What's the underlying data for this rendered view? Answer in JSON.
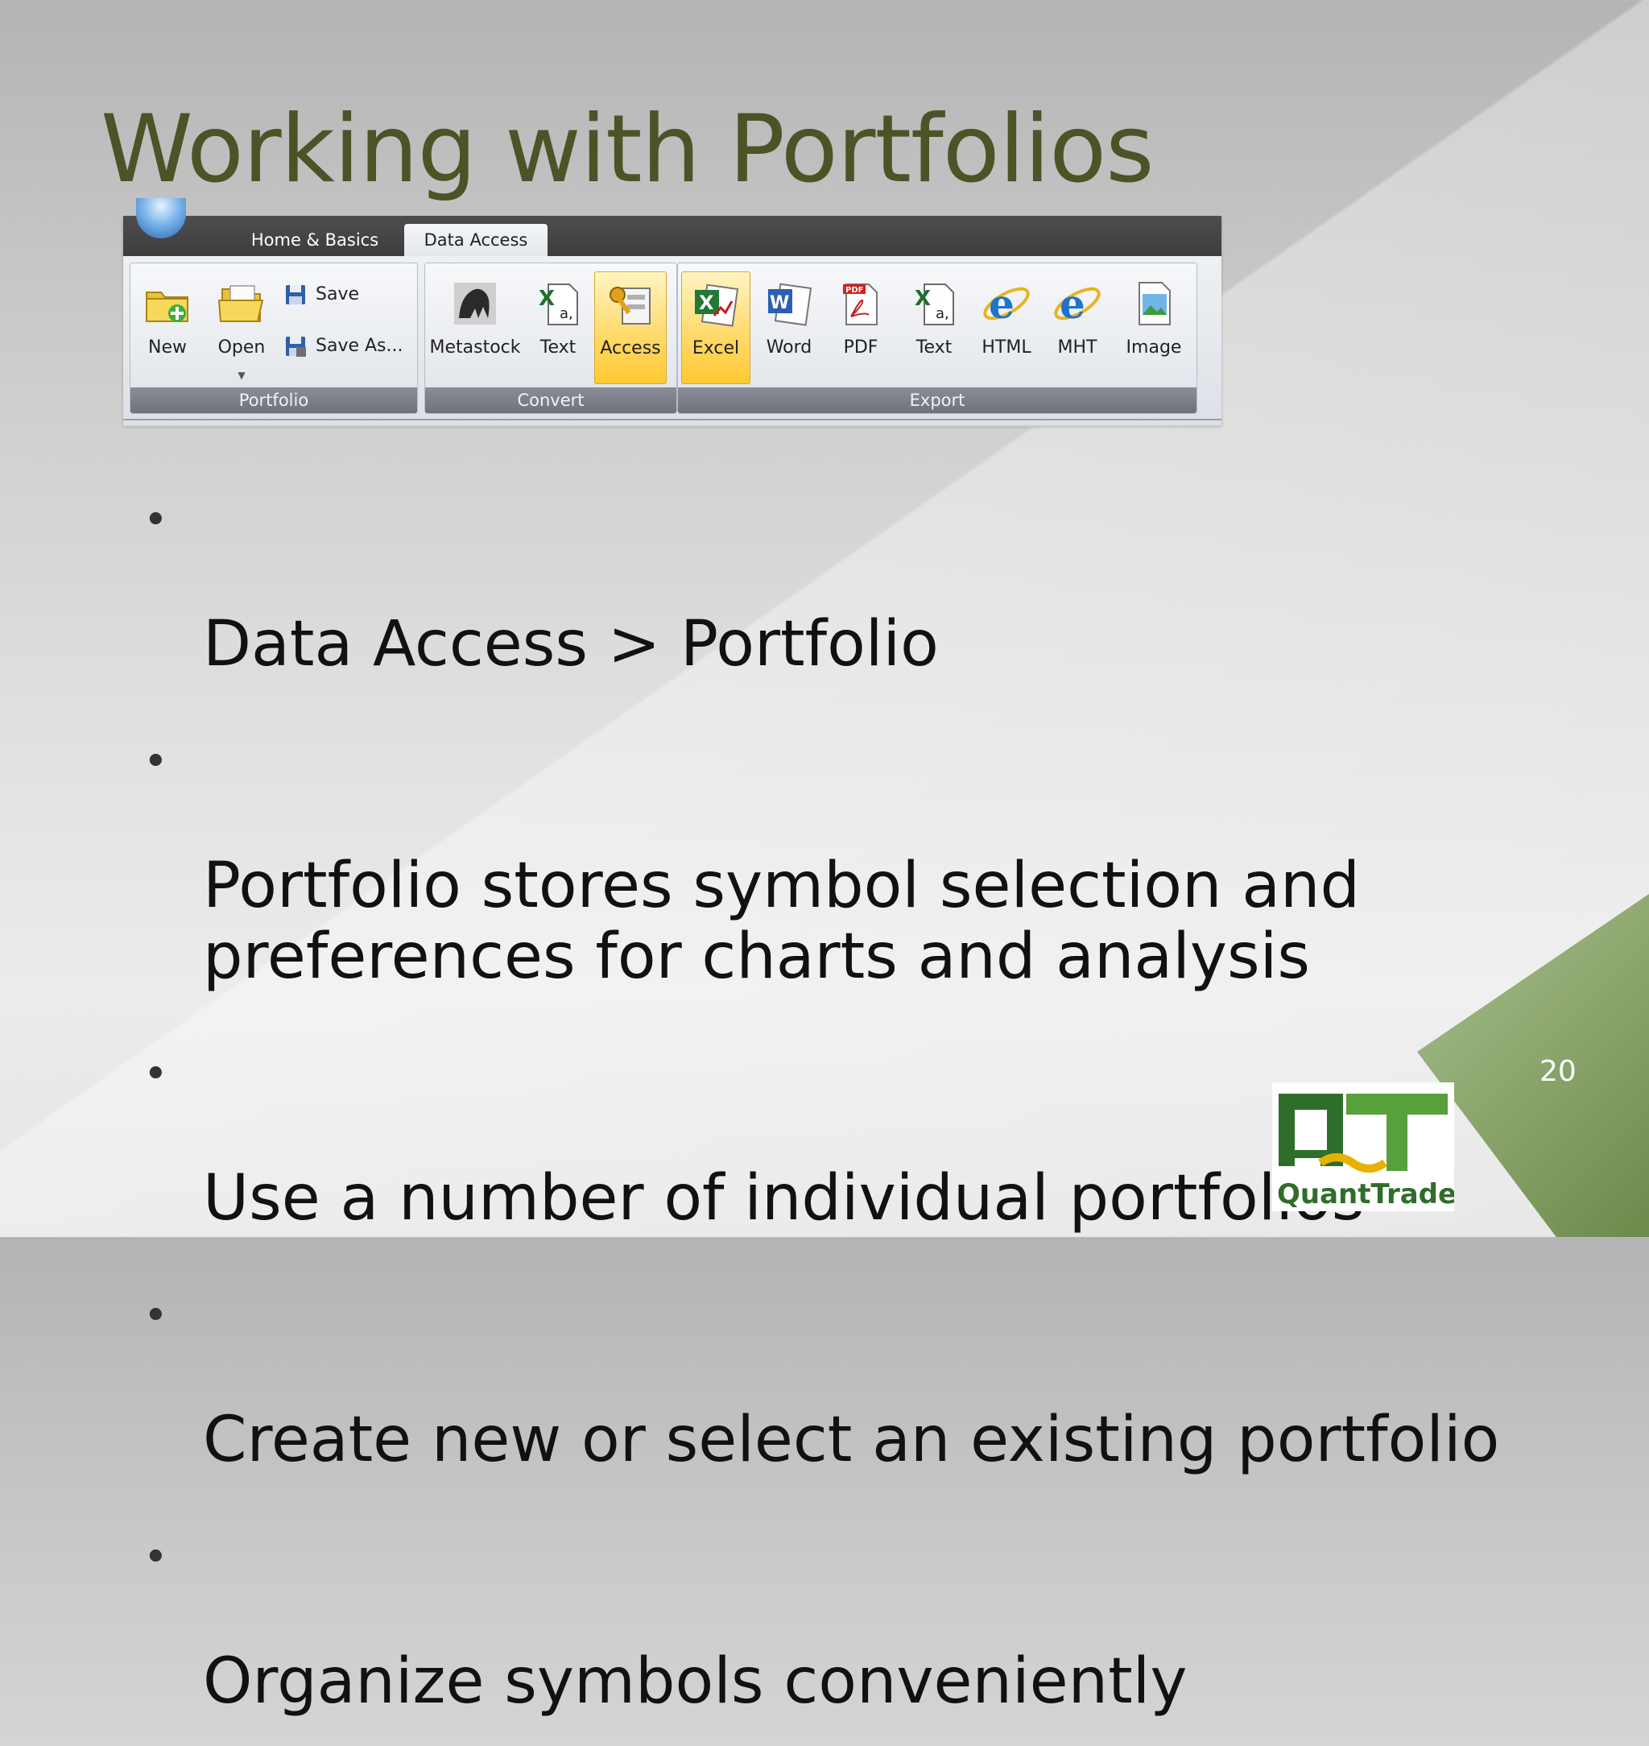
{
  "slide": {
    "title": "Working with Portfolios",
    "page_number": "20",
    "bullets": [
      "Data Access > Portfolio",
      "Portfolio stores symbol selection and\npreferences for charts and analysis",
      "Use a number of individual portfolios",
      "Create new or select an existing portfolio",
      "Organize symbols conveniently"
    ],
    "bullet_glyph": "•"
  },
  "ribbon": {
    "tabs": [
      {
        "label": "Home & Basics",
        "active": false
      },
      {
        "label": "Data Access",
        "active": true
      }
    ],
    "groups": {
      "portfolio": {
        "label": "Portfolio",
        "new_label": "New",
        "open_label": "Open",
        "save_label": "Save",
        "save_as_label": "Save As..."
      },
      "convert": {
        "label": "Convert",
        "metastock_label": "Metastock",
        "text_label": "Text",
        "access_label": "Access"
      },
      "export": {
        "label": "Export",
        "excel_label": "Excel",
        "word_label": "Word",
        "pdf_label": "PDF",
        "text_label": "Text",
        "html_label": "HTML",
        "mht_label": "MHT",
        "image_label": "Image"
      }
    }
  },
  "logo": {
    "letters": "QT",
    "brand_text": "QuantTrade"
  },
  "colors": {
    "title": "#4a5426",
    "accent_green": "#8fa870",
    "highlight": "#ffd866"
  }
}
